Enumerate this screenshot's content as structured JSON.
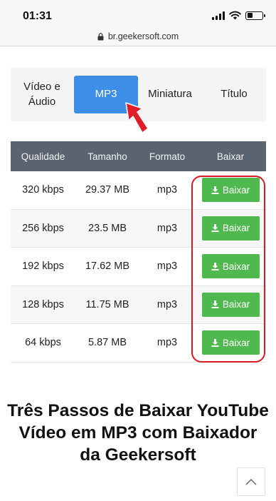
{
  "status_bar": {
    "time": "01:31"
  },
  "browser": {
    "url": "br.geekersoft.com"
  },
  "tabs": [
    {
      "label": "Vídeo e Áudio",
      "active": false
    },
    {
      "label": "MP3",
      "active": true
    },
    {
      "label": "Miniatura",
      "active": false
    },
    {
      "label": "Título",
      "active": false
    }
  ],
  "table": {
    "headers": [
      "Qualidade",
      "Tamanho",
      "Formato",
      "Baixar"
    ],
    "rows": [
      {
        "quality": "320 kbps",
        "size": "29.37 MB",
        "format": "mp3",
        "action": "Baixar"
      },
      {
        "quality": "256 kbps",
        "size": "23.5 MB",
        "format": "mp3",
        "action": "Baixar"
      },
      {
        "quality": "192 kbps",
        "size": "17.62 MB",
        "format": "mp3",
        "action": "Baixar"
      },
      {
        "quality": "128 kbps",
        "size": "11.75 MB",
        "format": "mp3",
        "action": "Baixar"
      },
      {
        "quality": "64 kbps",
        "size": "5.87 MB",
        "format": "mp3",
        "action": "Baixar"
      }
    ]
  },
  "heading": "Três Passos de Baixar YouTube Vídeo em MP3 com Baixador da Geekersoft",
  "icons": {
    "lock": "lock-icon",
    "download": "download-icon",
    "scroll_top": "chevron-up-icon",
    "annotation_arrow": "red-arrow-icon"
  },
  "colors": {
    "tab_active": "#3d8ee6",
    "table_header": "#5a6470",
    "download_button": "#4fb84f",
    "annotation": "#d91a25"
  }
}
